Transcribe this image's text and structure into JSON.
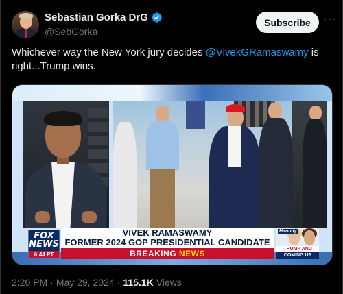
{
  "author": {
    "display_name": "Sebastian Gorka DrG",
    "handle": "@SebGorka",
    "verified": true
  },
  "actions": {
    "subscribe_label": "Subscribe",
    "more_label": "···"
  },
  "tweet": {
    "text_before": "Whichever way the New York jury decides ",
    "mention": "@VivekGRamaswamy",
    "text_after": " is right...Trump wins."
  },
  "video": {
    "network_line1": "FOX",
    "network_line2": "NEWS",
    "clock": "6:44 PT",
    "chyron_name": "VIVEK RAMASWAMY",
    "chyron_title": "FORMER 2024 GOP PRESIDENTIAL CANDIDATE",
    "breaking_word1": "BREAKING",
    "breaking_word2": "NEWS",
    "promo_show": "Hannity",
    "promo_line1": "TRUMP AND CARTER",
    "promo_line2": "COMING UP"
  },
  "meta": {
    "time": "2:20 PM",
    "sep1": "·",
    "date": "May 29, 2024",
    "sep2": "·",
    "views_count": "115.1K",
    "views_label": "Views"
  },
  "colors": {
    "accent": "#1d9bf0",
    "background": "#000000",
    "muted": "#71767b",
    "fox_red": "#c8102e",
    "fox_navy": "#0a2a66"
  }
}
